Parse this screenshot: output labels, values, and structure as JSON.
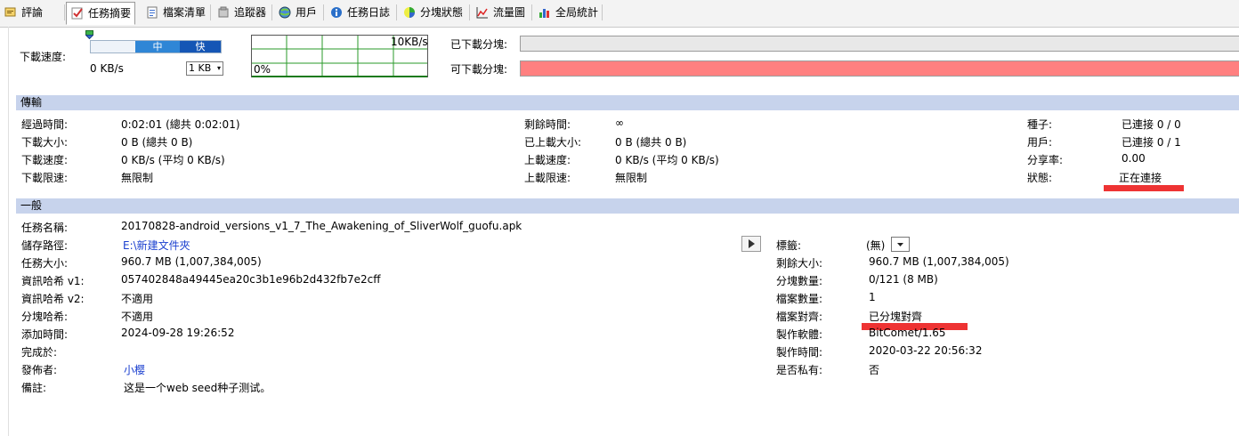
{
  "tabs": [
    {
      "label": "評論",
      "icon": "comment-icon"
    },
    {
      "label": "任務摘要",
      "icon": "task-summary-icon",
      "active": true
    },
    {
      "label": "檔案清單",
      "icon": "file-list-icon"
    },
    {
      "label": "追蹤器",
      "icon": "tracker-icon"
    },
    {
      "label": "用戶",
      "icon": "users-icon"
    },
    {
      "label": "任務日誌",
      "icon": "task-log-icon"
    },
    {
      "label": "分塊狀態",
      "icon": "piece-status-icon"
    },
    {
      "label": "流量圖",
      "icon": "traffic-chart-icon"
    },
    {
      "label": "全局統計",
      "icon": "global-stats-icon"
    }
  ],
  "speed_panel": {
    "label": "下載速度:",
    "slider_mid": "中",
    "slider_fast": "快",
    "current_speed": "0 KB/s",
    "unit": "1 KB",
    "graph_max": "10KB/s",
    "graph_min": "0%"
  },
  "pieces": {
    "downloaded_label": "已下載分塊:",
    "available_label": "可下載分塊:",
    "bar_colors": {
      "downloaded": "#e8e8e8",
      "available": "#ff8080"
    }
  },
  "transfer": {
    "title": "傳輸",
    "col1": [
      {
        "label": "經過時間:",
        "value": "0:02:01 (總共 0:02:01)"
      },
      {
        "label": "下載大小:",
        "value": "0 B (總共 0 B)"
      },
      {
        "label": "下載速度:",
        "value": "0 KB/s (平均 0 KB/s)"
      },
      {
        "label": "下載限速:",
        "value": "無限制"
      }
    ],
    "col2": [
      {
        "label": "剩餘時間:",
        "value": "∞"
      },
      {
        "label": "已上載大小:",
        "value": "0 B (總共 0 B)"
      },
      {
        "label": "上載速度:",
        "value": "0 KB/s (平均 0 KB/s)"
      },
      {
        "label": "上載限速:",
        "value": "無限制"
      }
    ],
    "col3": [
      {
        "label": "種子:",
        "value": "已連接 0 / 0"
      },
      {
        "label": "用戶:",
        "value": "已連接 0 / 1"
      },
      {
        "label": "分享率:",
        "value": "0.00"
      },
      {
        "label": "狀態:",
        "value": "正在連接"
      }
    ]
  },
  "general": {
    "title": "一般",
    "task_name_label": "任務名稱:",
    "task_name": "20170828-android_versions_v1_7_The_Awakening_of_SliverWolf_guofu.apk",
    "left": [
      {
        "label": "儲存路徑:",
        "value": "E:\\新建文件夾",
        "link": true
      },
      {
        "label": "任務大小:",
        "value": "960.7 MB (1,007,384,005)"
      },
      {
        "label": "資訊哈希 v1:",
        "value": "057402848a49445ea20c3b1e96b2d432fb7e2cff"
      },
      {
        "label": "資訊哈希 v2:",
        "value": "不適用"
      },
      {
        "label": "分塊哈希:",
        "value": "不適用"
      },
      {
        "label": "添加時間:",
        "value": "2024-09-28 19:26:52"
      },
      {
        "label": "完成於:",
        "value": ""
      },
      {
        "label": "發佈者:",
        "value": "小樱",
        "link": true
      },
      {
        "label": "備註:",
        "value": "这是一个web seed种子测试。"
      }
    ],
    "right": [
      {
        "label": "標籤:",
        "value": "(無)"
      },
      {
        "label": "剩餘大小:",
        "value": "960.7 MB (1,007,384,005)"
      },
      {
        "label": "分塊數量:",
        "value": "0/121 (8 MB)"
      },
      {
        "label": "檔案數量:",
        "value": "1"
      },
      {
        "label": "檔案對齊:",
        "value": "已分塊對齊"
      },
      {
        "label": "製作軟體:",
        "value": "BitComet/1.65"
      },
      {
        "label": "製作時間:",
        "value": "2020-03-22 20:56:32"
      },
      {
        "label": "是否私有:",
        "value": "否"
      }
    ]
  },
  "colors": {
    "section_header": "#c7d3ec",
    "annotation_red": "#ee3333",
    "link": "#1a3fcf"
  }
}
